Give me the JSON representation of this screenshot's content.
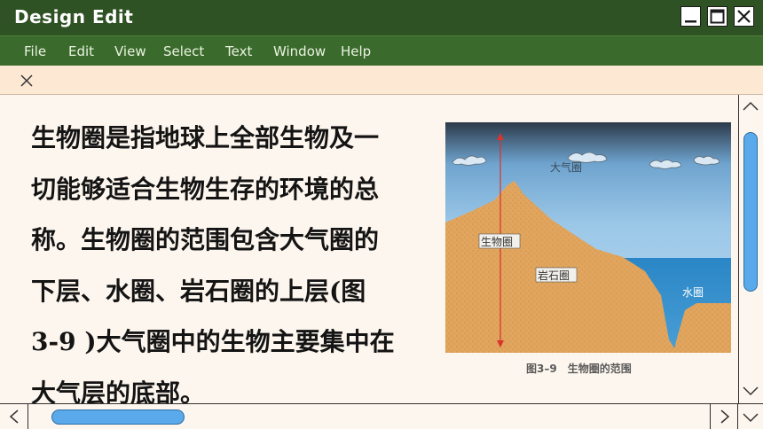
{
  "window": {
    "title": "Design Edit"
  },
  "menu": {
    "file": "File",
    "edit": "Edit",
    "view": "View",
    "select": "Select",
    "text": "Text",
    "window": "Window",
    "help": "Help"
  },
  "body_lines": [
    "生物圈是指地球上全部生物及一",
    "切能够适合生物生存的环境的总",
    "称。生物圈的范围包含大气圈的",
    "下层、水圈、岩石圈的上层(图",
    "3-9 )大气圈中的生物主要集中在",
    "大气层的底部。"
  ],
  "figure": {
    "label_atmosphere": "大气圈",
    "label_biosphere": "生物圈",
    "label_lithosphere": "岩石圈",
    "label_hydrosphere": "水圈",
    "caption": "图3–9　生物圈的范围"
  },
  "colors": {
    "titlebar": "#2f5224",
    "menubar": "#3a6b2c",
    "tabbar": "#fde9d3",
    "scroll_thumb": "#5aa9ea"
  },
  "icons": {
    "close_tab": "close-icon",
    "minimize": "minimize-icon",
    "maximize": "maximize-icon",
    "close_window": "close-icon",
    "scroll_up": "chevron-up-icon",
    "scroll_down": "chevron-down-icon",
    "scroll_left": "chevron-left-icon",
    "scroll_right": "chevron-right-icon"
  }
}
